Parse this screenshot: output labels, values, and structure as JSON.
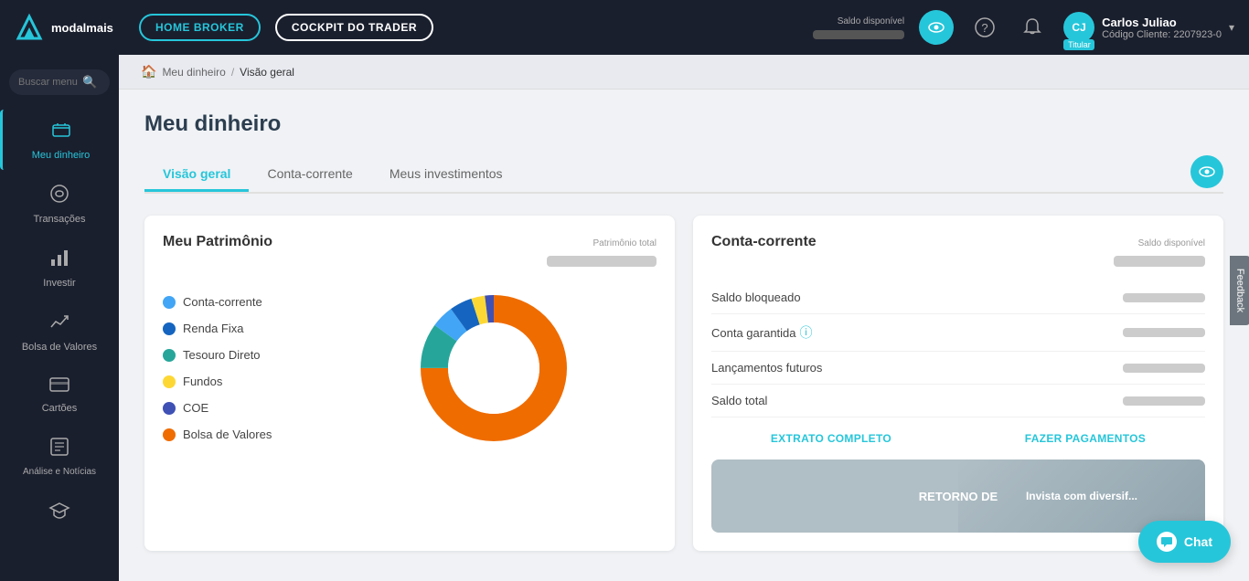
{
  "topnav": {
    "logo_text": "modalmais",
    "home_broker_label": "HOME BROKER",
    "cockpit_label": "COCKPIT DO TRADER",
    "saldo_disponivel_label": "Saldo disponível",
    "user": {
      "name": "Carlos Juliao",
      "code_label": "Código Cliente:",
      "code": "2207923-0",
      "initials": "CJ",
      "titular_label": "Titular"
    }
  },
  "sidebar": {
    "search_placeholder": "Buscar menu",
    "items": [
      {
        "id": "meu-dinheiro",
        "label": "Meu dinheiro",
        "icon": "💰",
        "active": true
      },
      {
        "id": "transacoes",
        "label": "Transações",
        "icon": "🔄",
        "active": false
      },
      {
        "id": "investir",
        "label": "Investir",
        "icon": "📈",
        "active": false
      },
      {
        "id": "bolsa-valores",
        "label": "Bolsa de Valores",
        "icon": "📊",
        "active": false
      },
      {
        "id": "cartoes",
        "label": "Cartões",
        "icon": "💳",
        "active": false
      },
      {
        "id": "analise-noticias",
        "label": "Análise e Notícias",
        "icon": "📰",
        "active": false
      },
      {
        "id": "educacao",
        "label": "",
        "icon": "🎓",
        "active": false
      }
    ]
  },
  "breadcrumb": {
    "home_icon": "🏠",
    "parent": "Meu dinheiro",
    "separator": "/",
    "current": "Visão geral"
  },
  "page": {
    "title": "Meu dinheiro"
  },
  "tabs": [
    {
      "id": "visao-geral",
      "label": "Visão geral",
      "active": true
    },
    {
      "id": "conta-corrente-tab",
      "label": "Conta-corrente",
      "active": false
    },
    {
      "id": "meus-investimentos",
      "label": "Meus investimentos",
      "active": false
    }
  ],
  "patrimonio_card": {
    "title": "Meu Patrimônio",
    "total_label": "Patrimônio total",
    "legend": [
      {
        "id": "conta-corrente",
        "label": "Conta-corrente",
        "color": "#42a5f5"
      },
      {
        "id": "renda-fixa",
        "label": "Renda Fixa",
        "color": "#1565c0"
      },
      {
        "id": "tesouro-direto",
        "label": "Tesouro Direto",
        "color": "#26a69a"
      },
      {
        "id": "fundos",
        "label": "Fundos",
        "color": "#fdd835"
      },
      {
        "id": "coe",
        "label": "COE",
        "color": "#3f51b5"
      },
      {
        "id": "bolsa-valores",
        "label": "Bolsa de Valores",
        "color": "#ef6c00"
      }
    ],
    "donut": {
      "segments": [
        {
          "label": "Conta-corrente",
          "pct": 5,
          "color": "#42a5f5"
        },
        {
          "label": "Renda Fixa",
          "pct": 5,
          "color": "#1565c0"
        },
        {
          "label": "Tesouro Direto",
          "pct": 10,
          "color": "#26a69a"
        },
        {
          "label": "Fundos",
          "pct": 3,
          "color": "#fdd835"
        },
        {
          "label": "COE",
          "pct": 2,
          "color": "#3f51b5"
        },
        {
          "label": "Bolsa de Valores",
          "pct": 75,
          "color": "#ef6c00"
        }
      ]
    }
  },
  "conta_corrente_card": {
    "title": "Conta-corrente",
    "saldo_disponivel_label": "Saldo disponível",
    "rows": [
      {
        "id": "saldo-bloqueado",
        "label": "Saldo bloqueado"
      },
      {
        "id": "conta-garantida",
        "label": "Conta garantida",
        "has_info": true
      },
      {
        "id": "lancamentos-futuros",
        "label": "Lançamentos futuros"
      },
      {
        "id": "saldo-total",
        "label": "Saldo total"
      }
    ],
    "extrato_btn": "EXTRATO COMPLETO",
    "pagamento_btn": "FAZER PAGAMENTOS"
  },
  "promo": {
    "text": "RETORNO DE"
  },
  "chat": {
    "label": "Chat"
  },
  "feedback": {
    "label": "Feedback"
  }
}
